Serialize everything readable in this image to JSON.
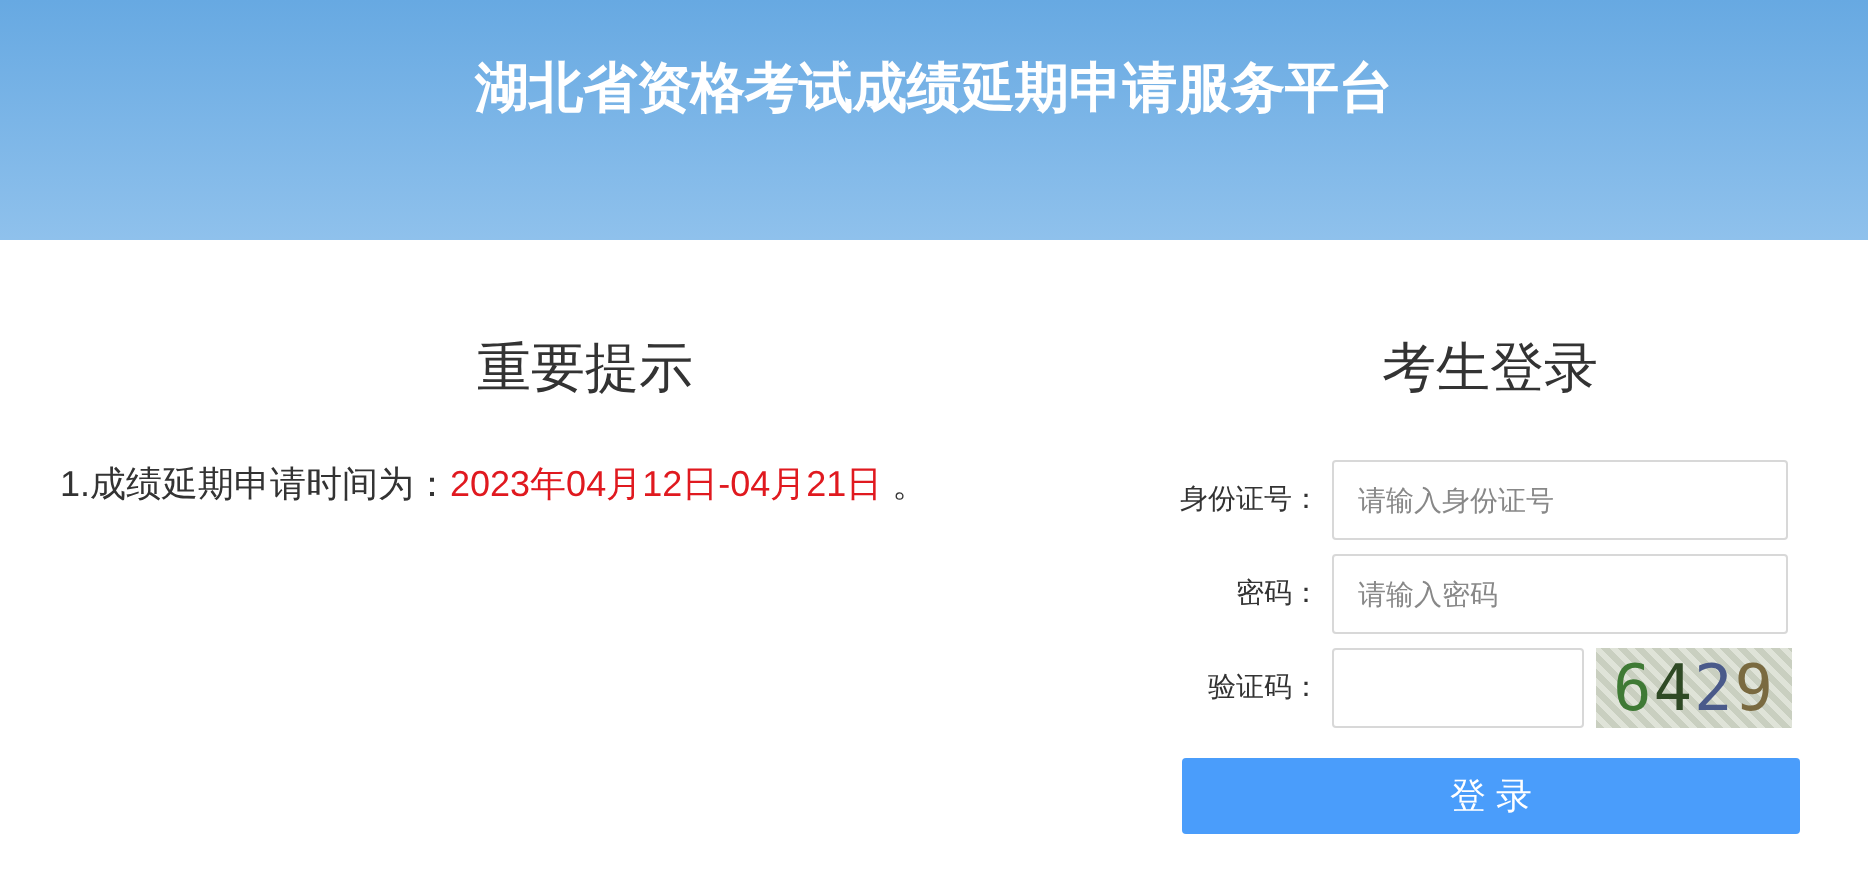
{
  "header": {
    "title": "湖北省资格考试成绩延期申请服务平台"
  },
  "notice": {
    "heading": "重要提示",
    "items": [
      {
        "parts": [
          {
            "text": "1.成绩延期申请时间为：",
            "highlight": false
          },
          {
            "text": "2023年04月12日-04月21日",
            "highlight": true
          },
          {
            "text": " 。",
            "highlight": false
          }
        ]
      }
    ]
  },
  "login": {
    "heading": "考生登录",
    "fields": [
      {
        "kind": "text",
        "label": "身份证号：",
        "placeholder": "请输入身份证号"
      },
      {
        "kind": "password",
        "label": "密码：",
        "placeholder": "请输入密码"
      },
      {
        "kind": "captcha",
        "label": "验证码：",
        "captcha": "6429"
      }
    ],
    "button": "登 录"
  }
}
